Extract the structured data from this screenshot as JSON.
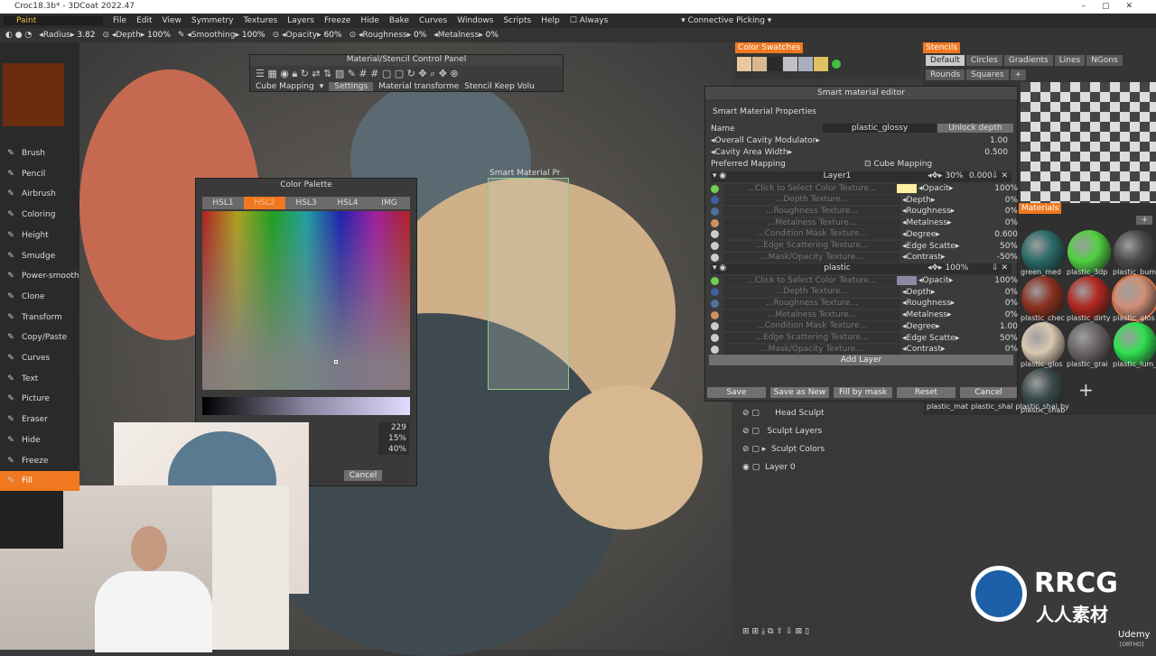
{
  "window": {
    "title": "Croc18.3b* - 3DCoat 2022.47"
  },
  "menubar": {
    "mode": "Paint",
    "items": [
      "File",
      "Edit",
      "View",
      "Symmetry",
      "Textures",
      "Layers",
      "Freeze",
      "Hide",
      "Bake",
      "Curves",
      "Windows",
      "Scripts",
      "Help"
    ],
    "always": "Always",
    "picking": "Connective  Picking"
  },
  "toolopts": {
    "radius_label": "Radius",
    "radius": "3.82",
    "depth_label": "Depth",
    "depth": "100%",
    "smoothing_label": "Smoothing",
    "smoothing": "100%",
    "opacity_label": "Opacity",
    "opacity": "60%",
    "roughness_label": "Roughness",
    "roughness": "0%",
    "metalness_label": "Metalness",
    "metalness": "0%"
  },
  "tools": [
    "Brush",
    "Pencil",
    "Airbrush",
    "Coloring",
    "Height",
    "Smudge",
    "Power-smooth",
    "Clone",
    "Transform",
    "Copy/Paste",
    "Curves",
    "Text",
    "Picture",
    "Eraser",
    "Hide",
    "Freeze",
    "Fill"
  ],
  "active_tool": "Fill",
  "current_color": "#6b2c10",
  "mscp": {
    "title": "Material/Stencil  Control  Panel",
    "mapping": "Cube  Mapping",
    "settings": "Settings",
    "material": "Material  transforme",
    "stencil": "Stencil  Keep  Volu"
  },
  "smart_preview_label": "Smart Material  Pr",
  "palette": {
    "title": "Color  Palette",
    "tabs": [
      "HSL1",
      "HSL2",
      "HSL3",
      "HSL4",
      "IMG"
    ],
    "active_tab": "HSL2",
    "values": [
      "229",
      "15%",
      "40%"
    ],
    "cancel": "Cancel"
  },
  "swatches": {
    "title": "Color  Swatches",
    "colors": [
      "#e8c8a0",
      "#d8b890",
      "#2a2a2a",
      "#c0c0c8",
      "#a8b0c0",
      "#e0c060",
      "#40c040"
    ]
  },
  "stencils": {
    "title": "Stencils",
    "tabs": [
      "Default",
      "Circles",
      "Gradients",
      "Lines",
      "NGons",
      "Rounds",
      "Squares"
    ],
    "active": "Default"
  },
  "materials": {
    "title": "Materials",
    "items": [
      {
        "label": "green_med",
        "color": "#2a6a68"
      },
      {
        "label": "plastic_3dp",
        "color": "#50d040"
      },
      {
        "label": "plastic_bum",
        "color": "#4a4a4a"
      },
      {
        "label": "plastic_chec",
        "color": "#8a3020"
      },
      {
        "label": "plastic_dirty",
        "color": "#b02820"
      },
      {
        "label": "plastic_glos",
        "color": "#d09078"
      },
      {
        "label": "plastic_glos",
        "color": "#d8c8b0"
      },
      {
        "label": "plastic_grai",
        "color": "#6a6464"
      },
      {
        "label": "plastic_lum_",
        "color": "#30e050"
      },
      {
        "label": "plastic_shab",
        "color": "#3a4a4a"
      }
    ],
    "bottom_labels": [
      "plastic_mat",
      "plastic_shal",
      "plastic_shal",
      "by"
    ]
  },
  "sme": {
    "title": "Smart material editor",
    "props": "Smart Material Properties",
    "name_label": "Name",
    "name": "plastic_glossy",
    "unlock": "Unlock  depth",
    "cavity_mod_label": "Overall  Cavity  Modulator",
    "cavity_mod": "1.00",
    "cavity_width_label": "Cavity  Area  Width",
    "cavity_width": "0.500",
    "mapping_label": "Preferred  Mapping",
    "mapping": "Cube  Mapping",
    "layers": [
      {
        "name": "Layer1",
        "scale": "30%",
        "offset": "0.000",
        "swatch": "#fff0a0",
        "rows": [
          [
            "...Click  to  Select  Color  Texture...",
            "Opacit",
            "100%"
          ],
          [
            "...Depth  Texture...",
            "Depth",
            "0%"
          ],
          [
            "...Roughness  Texture...",
            "Roughness",
            "0%"
          ],
          [
            "...Metalness  Texture...",
            "Metalness",
            "0%"
          ],
          [
            "...Condition  Mask  Texture...",
            "Degree",
            "0.600"
          ],
          [
            "...Edge  Scattering  Texture...",
            "Edge  Scatte",
            "50%"
          ],
          [
            "...Mask/Opacity  Texture...",
            "Contrast",
            "-50%"
          ]
        ]
      },
      {
        "name": "plastic",
        "scale": "100%",
        "offset": "",
        "swatch": "#8a8aa0",
        "rows": [
          [
            "...Click  to  Select  Color  Texture...",
            "Opacit",
            "100%"
          ],
          [
            "...Depth  Texture...",
            "Depth",
            "0%"
          ],
          [
            "...Roughness  Texture...",
            "Roughness",
            "0%"
          ],
          [
            "...Metalness  Texture...",
            "Metalness",
            "0%"
          ],
          [
            "...Condition  Mask  Texture...",
            "Degree",
            "1.00"
          ],
          [
            "...Edge  Scattering  Texture...",
            "Edge  Scatte",
            "50%"
          ],
          [
            "...Mask/Opacity  Texture...",
            "Contrast",
            "0%"
          ]
        ]
      }
    ],
    "add_layer": "Add  Layer",
    "buttons": [
      "Save",
      "Save  as  New",
      "Fill  by  mask",
      "Reset",
      "Cancel"
    ]
  },
  "layers": [
    {
      "name": "Head  Sculpt",
      "visible": false
    },
    {
      "name": "Sculpt  Layers",
      "visible": false
    },
    {
      "name": "Sculpt  Colors",
      "visible": false
    },
    {
      "name": "Layer  0",
      "visible": true
    }
  ],
  "watermark": {
    "brand": "RRCG",
    "sub": "人人素材",
    "udemy": "Udemy",
    "ortho": "[ORTHO]"
  }
}
